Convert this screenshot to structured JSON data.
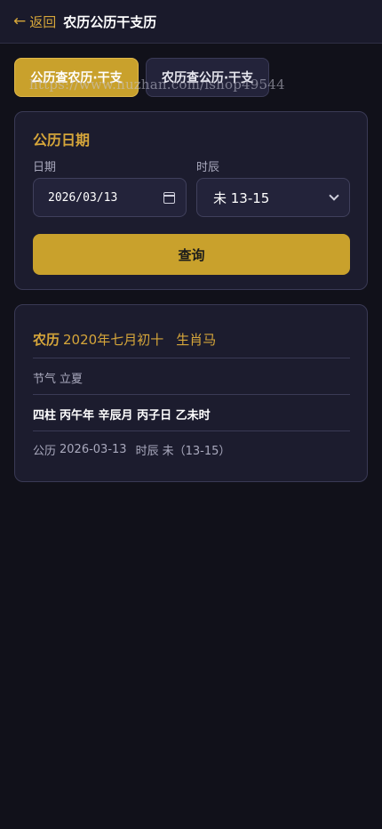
{
  "header": {
    "back_arrow": "←",
    "back_label": "返回",
    "title": "农历公历干支历"
  },
  "tabs": [
    {
      "label": "公历查农历·干支",
      "active": true
    },
    {
      "label": "农历查公历·干支",
      "active": false
    }
  ],
  "watermark": "https://www.huzhan.com/ishop49544",
  "form": {
    "title": "公历日期",
    "date_label": "日期",
    "date_value": "2026/03/13",
    "hour_label": "时辰",
    "hour_value": "未 13-15",
    "query_label": "查询"
  },
  "result": {
    "lunar_label": "农历",
    "lunar_date": "2020年七月初十",
    "zodiac": "生肖马",
    "term_label": "节气",
    "term_value": "立夏",
    "pillars_label": "四柱",
    "pillars_value": "丙午年 辛辰月 丙子日 乙未时",
    "solar_label": "公历",
    "solar_value": "2026-03-13",
    "hour_label": "时辰",
    "hour_value": "未（13-15）"
  },
  "colors": {
    "accent": "#c9a12c",
    "accent_text": "#d6a63a",
    "background": "#11111a",
    "card": "#1c1c2e"
  }
}
